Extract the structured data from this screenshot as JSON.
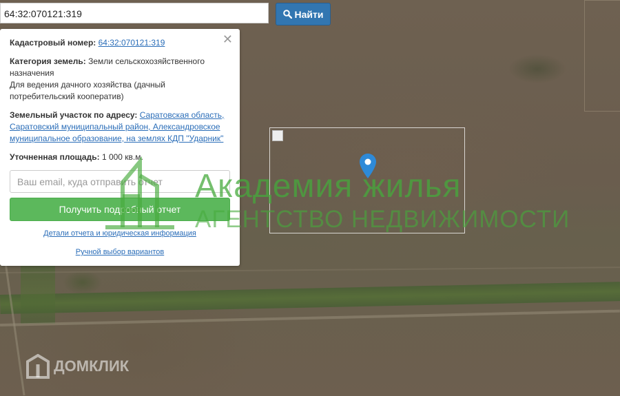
{
  "search": {
    "value": "64:32:070121:319",
    "button_label": "Найти"
  },
  "panel": {
    "cadastral_label": "Кадастровый номер:",
    "cadastral_value": "64:32:070121:319",
    "category_label": "Категория земель:",
    "category_value": "Земли сельскохозяйственного назначения",
    "usage_value": "Для ведения дачного хозяйства (дачный потребительский кооператив)",
    "address_label": "Земельный участок по адресу:",
    "address_value": "Саратовская область, Саратовский муниципальный район, Александровское муниципальное образование, на землях КДП \"Ударник\"",
    "area_label": "Уточненная площадь:",
    "area_value": "1 000 кв.м.",
    "email_placeholder": "Ваш email, куда отправить отчет",
    "report_button": "Получить подробный отчет",
    "details_link": "Детали отчета и юридическая информация",
    "manual_link": "Ручной выбор вариантов"
  },
  "watermark": {
    "title": "Академия жилья",
    "subtitle": "агентство недвижимости"
  },
  "brand": {
    "domclick": "ДОМКЛИК"
  },
  "colors": {
    "search_button": "#3276b1",
    "report_button": "#5cb85c",
    "marker": "#2e8ad8",
    "watermark": "#46aa3c"
  }
}
